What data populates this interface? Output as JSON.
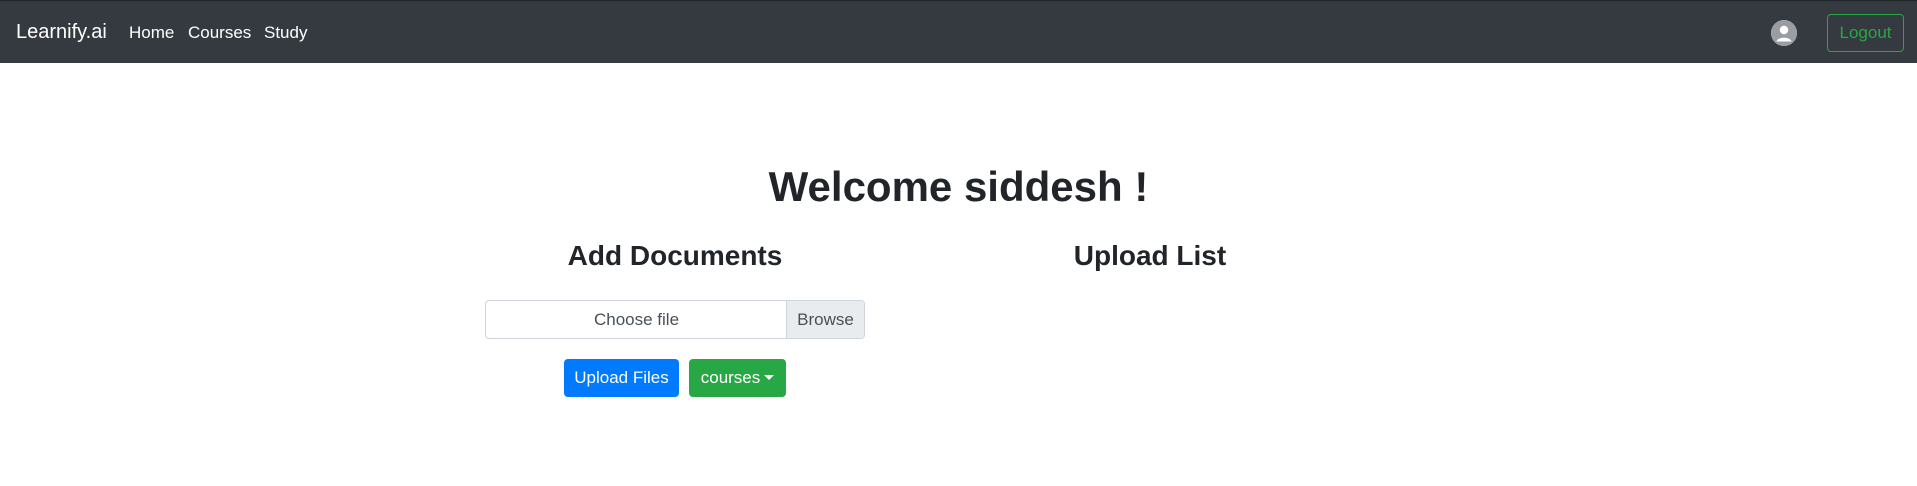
{
  "navbar": {
    "brand": "Learnify.ai",
    "links": [
      "Home",
      "Courses",
      "Study"
    ],
    "avatar_icon": "user-avatar-icon",
    "logout_label": "Logout"
  },
  "main": {
    "welcome": "Welcome siddesh !",
    "add_documents_title": "Add Documents",
    "upload_list_title": "Upload List",
    "file_input": {
      "placeholder": "Choose file",
      "browse_label": "Browse"
    },
    "upload_button": "Upload Files",
    "courses_dropdown": "courses"
  },
  "colors": {
    "navbar_bg": "#343a40",
    "primary": "#007bff",
    "success": "#28a745"
  }
}
